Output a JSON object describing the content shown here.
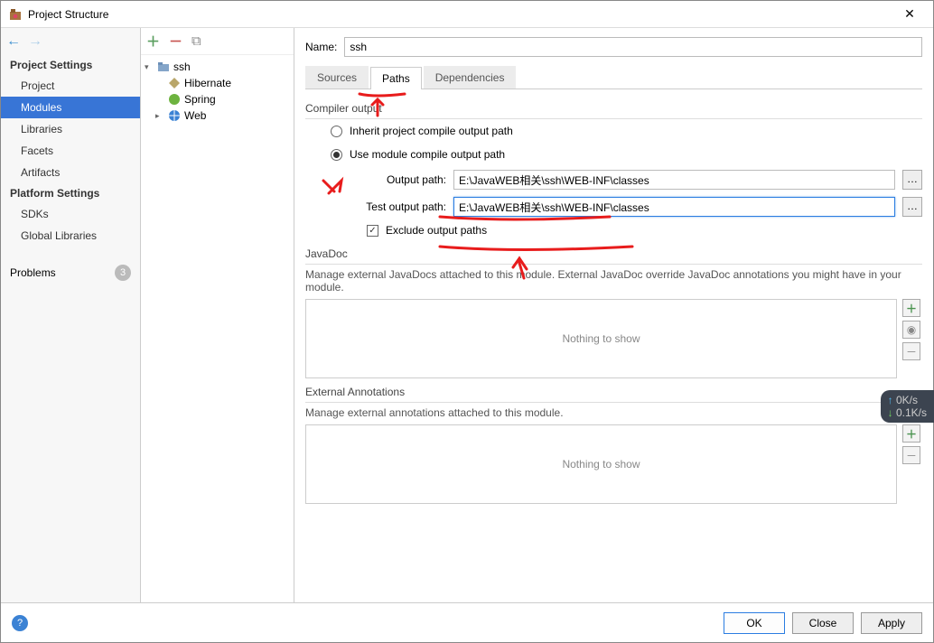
{
  "window": {
    "title": "Project Structure"
  },
  "leftnav": {
    "projectSettings": "Project Settings",
    "items1": [
      "Project",
      "Modules",
      "Libraries",
      "Facets",
      "Artifacts"
    ],
    "selected": 1,
    "platformSettings": "Platform Settings",
    "items2": [
      "SDKs",
      "Global Libraries"
    ],
    "problems": "Problems",
    "problemsCount": "3"
  },
  "tree": {
    "root": "ssh",
    "children": [
      {
        "label": "Hibernate",
        "icon": "hibernate"
      },
      {
        "label": "Spring",
        "icon": "spring"
      },
      {
        "label": "Web",
        "icon": "web",
        "hasChildren": true
      }
    ]
  },
  "main": {
    "nameLabel": "Name:",
    "nameValue": "ssh",
    "tabs": [
      "Sources",
      "Paths",
      "Dependencies"
    ],
    "activeTab": 1,
    "compilerOutput": "Compiler output",
    "inherit": "Inherit project compile output path",
    "useModule": "Use module compile output path",
    "outputPathLabel": "Output path:",
    "outputPath": "E:\\JavaWEB相关\\ssh\\WEB-INF\\classes",
    "testOutputPathLabel": "Test output path:",
    "testOutputPath": "E:\\JavaWEB相关\\ssh\\WEB-INF\\classes",
    "excludeLabel": "Exclude output paths",
    "excludeChecked": true,
    "javaDoc": "JavaDoc",
    "javaDocDesc": "Manage external JavaDocs attached to this module. External JavaDoc override JavaDoc annotations you might have in your module.",
    "nothing": "Nothing to show",
    "extAnno": "External Annotations",
    "extAnnoDesc": "Manage external annotations attached to this module."
  },
  "footer": {
    "ok": "OK",
    "close": "Close",
    "apply": "Apply"
  },
  "overlay": {
    "up": "0K/s",
    "down": "0.1K/s"
  }
}
